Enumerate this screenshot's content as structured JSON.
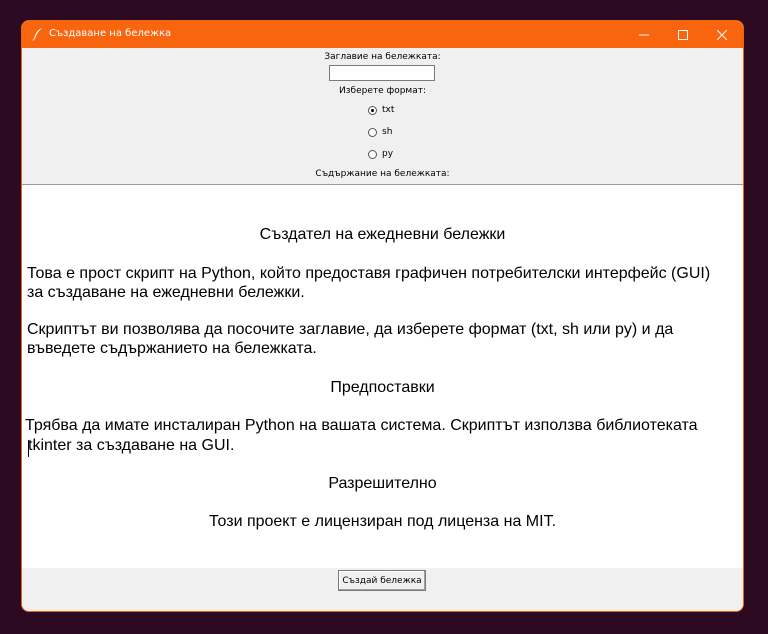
{
  "window": {
    "title": "Създаване на бележка",
    "accent": "#f9650e"
  },
  "form": {
    "title_label": "Заглавие на бележката:",
    "title_value": "",
    "format_label": "Изберете формат:",
    "formats": [
      {
        "label": "txt",
        "selected": true
      },
      {
        "label": "sh",
        "selected": false
      },
      {
        "label": "py",
        "selected": false
      }
    ],
    "content_label": "Съдържание на бележката:"
  },
  "content": {
    "heading1": "Създател на ежедневни бележки",
    "p1_line1": "Това е прост скрипт на Python, който предоставя графичен потребителски интерфейс (GUI)",
    "p1_line2": "за създаване на ежедневни бележки.",
    "p2_line1": "Скриптът ви позволява да посочите заглавие, да изберете формат (txt, sh или py) и да",
    "p2_line2": "въведете съдържанието на бележката.",
    "heading2": "Предпоставки",
    "p3_line1": "Трябва да имате инсталиран Python на вашата система. Скриптът използва библиотеката",
    "p3_line2": "tkinter за създаване на GUI.",
    "heading3": "Разрешително",
    "p4_line1": "Този проект е лицензиран под лиценза на MIT."
  },
  "actions": {
    "create_label": "Създай бележка"
  }
}
